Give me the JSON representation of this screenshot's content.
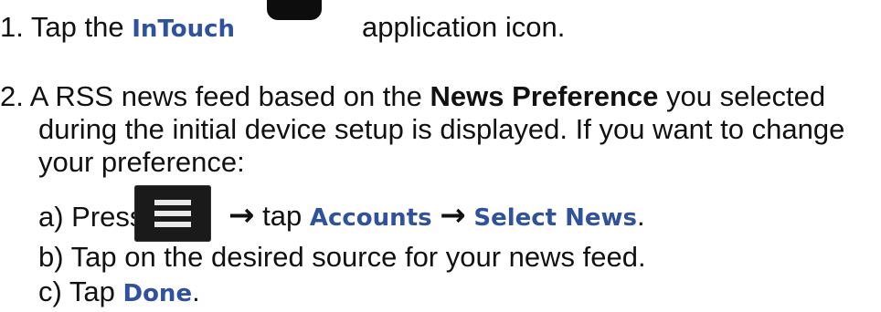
{
  "steps": {
    "s1": {
      "num": "1.",
      "pre": "Tap the",
      "app": "InTouch",
      "post": "application icon."
    },
    "s2": {
      "num": "2.",
      "l1a": "A RSS news feed based on the",
      "l1b": "News Preference",
      "l1c": "you selected",
      "l2": "during the initial device setup is displayed. If you want to change",
      "l3": "your preference:",
      "a_pre": "a) Press",
      "arrow": "→",
      "a_tap": "tap",
      "accounts": "Accounts",
      "select_news": "Select News",
      "period": ".",
      "b": "b) Tap on the desired source for your news feed.",
      "c_pre": "c) Tap",
      "done": "Done"
    }
  },
  "icons": {
    "app": "intouch-app-icon",
    "menu": "menu-icon"
  },
  "colors": {
    "highlight": "#2e52a0",
    "text": "#111111"
  }
}
